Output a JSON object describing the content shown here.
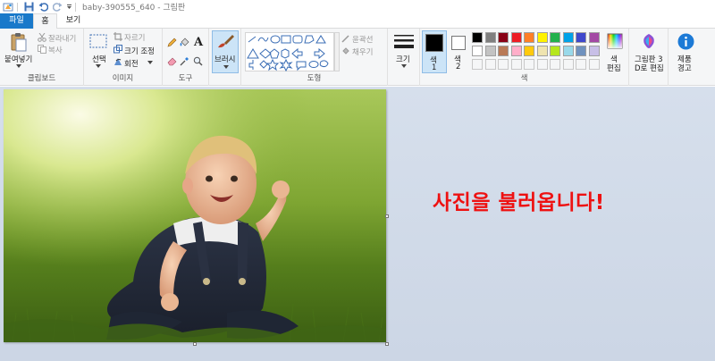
{
  "titlebar": {
    "title": "baby-390555_640 - 그림판"
  },
  "tabs": [
    {
      "label": "파일"
    },
    {
      "label": "홈"
    },
    {
      "label": "보기"
    }
  ],
  "ribbon": {
    "clipboard": {
      "paste": "붙여넣기",
      "cut": "잘라내기",
      "copy": "복사",
      "group": "클립보드"
    },
    "image": {
      "select": "선택",
      "crop": "자르기",
      "resize": "크기 조정",
      "rotate": "회전",
      "group": "이미지"
    },
    "tools": {
      "group": "도구"
    },
    "brushes": {
      "label": "브러시"
    },
    "shapes": {
      "outline": "윤곽선",
      "fill": "채우기",
      "group": "도형"
    },
    "size": {
      "label": "크기"
    },
    "colors": {
      "color1": "색",
      "color1_num": "1",
      "color2": "색",
      "color2_num": "2",
      "color1_value": "#000000",
      "color2_value": "#ffffff",
      "edit_l1": "색",
      "edit_l2": "편집",
      "group": "색",
      "palette_row1": [
        "#000000",
        "#7f7f7f",
        "#880015",
        "#ed1c24",
        "#ff7f27",
        "#fff200",
        "#22b14c",
        "#00a2e8",
        "#3f48cc",
        "#a349a4"
      ],
      "palette_row2": [
        "#ffffff",
        "#c3c3c3",
        "#b97a57",
        "#ffaec9",
        "#ffc90e",
        "#efe4b0",
        "#b5e61d",
        "#99d9ea",
        "#7092be",
        "#c8bfe7"
      ]
    },
    "paint3d": {
      "l1": "그림판 3",
      "l2": "D로 편집"
    },
    "alert": {
      "l1": "제품",
      "l2": "경고"
    }
  },
  "canvas": {
    "message": "사진을 불러옵니다!"
  }
}
